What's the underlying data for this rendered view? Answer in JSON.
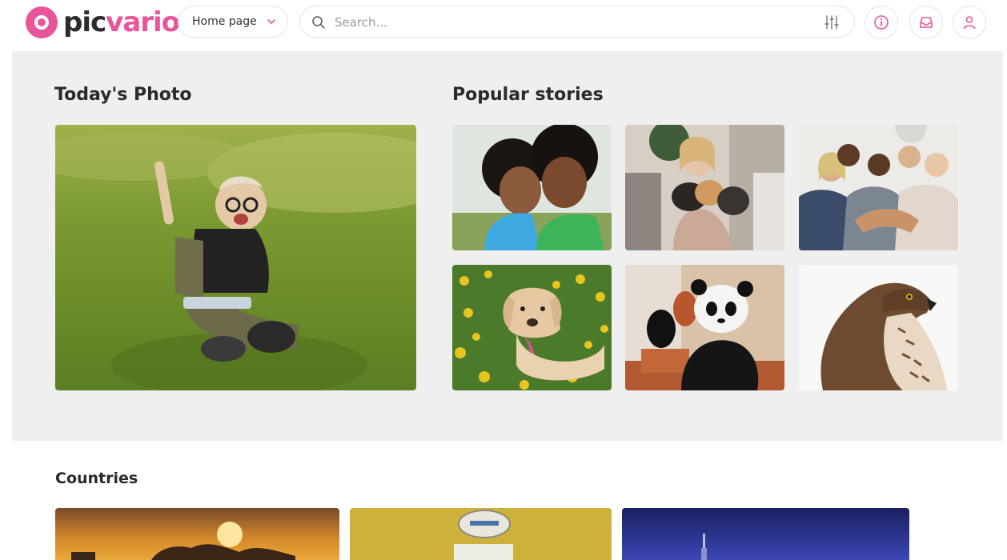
{
  "header": {
    "logo_part1": "pic",
    "logo_part2": "vario",
    "home_select_label": "Home page",
    "search_placeholder": "Search..."
  },
  "colors": {
    "brand": "#e8559a",
    "featured_bg": "#efefef"
  },
  "icons": [
    "search-icon",
    "sliders-icon",
    "info-icon",
    "inbox-icon",
    "user-icon",
    "chevron-down-icon"
  ],
  "featured": {
    "todays_photo_title": "Today's Photo",
    "popular_title": "Popular stories",
    "todays_photo_subject": "child-on-grass",
    "stories": [
      {
        "subject": "kids-smiling"
      },
      {
        "subject": "girl-with-kittens"
      },
      {
        "subject": "team-hands"
      },
      {
        "subject": "dog-in-flowers"
      },
      {
        "subject": "panda-cub"
      },
      {
        "subject": "hawk"
      }
    ]
  },
  "countries": {
    "title": "Countries",
    "cards": [
      {
        "subject": "sunset-landscape"
      },
      {
        "subject": "yellow-wall-sign"
      },
      {
        "subject": "night-city-skyline"
      }
    ]
  }
}
